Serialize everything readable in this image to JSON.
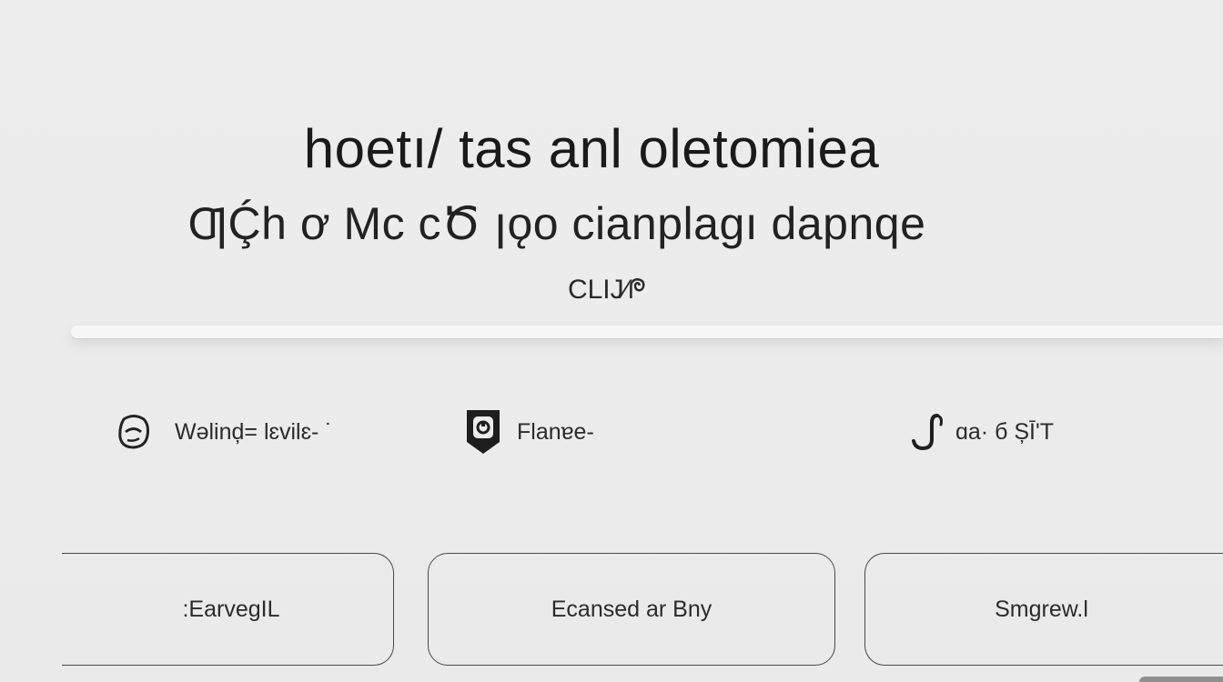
{
  "hero": {
    "title": "hoetı/  tas anl oletomiea",
    "subtitle": "ƢḈh ơ Mc cԾ ꞁǫo cianplagı dapnqe",
    "note": "CLIJ⁄ᖘ"
  },
  "info": [
    {
      "icon": "face-outline-icon",
      "label": "Wəlinḑ= lɛvilɛ- ˙"
    },
    {
      "icon": "shield-lock-icon",
      "label": "Flanɐe-"
    },
    {
      "icon": "hook-glyph-icon",
      "label": "ɑa·  б  ȘĪ'T"
    }
  ],
  "options": [
    {
      "label": ":EarvegIL"
    },
    {
      "label": "Ecansed ar Bny"
    },
    {
      "label": "Smgrew.l"
    }
  ],
  "colors": {
    "background": "#ececec",
    "text": "#1b1b1b",
    "outline": "#4a4a4a",
    "shelf": "#f7f7f7"
  }
}
